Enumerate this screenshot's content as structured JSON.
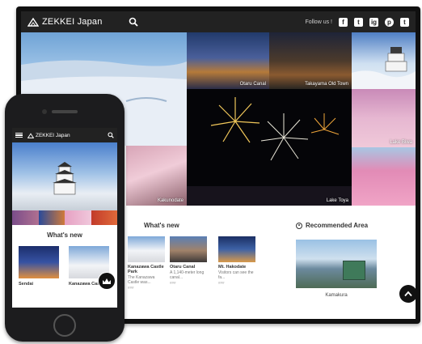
{
  "site": {
    "logo_text": "ZEKKEI Japan",
    "follow_label": "Follow us !",
    "social": [
      "f",
      "t",
      "ig",
      "p",
      "t"
    ]
  },
  "hero": {
    "tiles": [
      {
        "label": "Otaru Canal"
      },
      {
        "label": "Takayama Old Town"
      },
      {
        "label": "Lake Toya"
      },
      {
        "label": "Lake Biwa"
      },
      {
        "label": "Kakunodate"
      }
    ]
  },
  "whats_new": {
    "title": "What's new",
    "cards": [
      {
        "title": "Kanazawa Castle Park",
        "desc": "The Kanazawa Castle was...",
        "meta": "###"
      },
      {
        "title": "Otaru Canal",
        "desc": "A 1,140-meter long canal...",
        "meta": "###"
      },
      {
        "title": "Mt. Hakodate",
        "desc": "Visitors can see the fa...",
        "meta": "###"
      }
    ]
  },
  "recommended": {
    "title": "Recommended Area",
    "area": "Kamakura"
  },
  "phone": {
    "logo_text": "ZEKKEI Japan",
    "whats_new_title": "What's new",
    "cards": [
      {
        "label": "Sendai"
      },
      {
        "label": "Kanazawa Castle"
      }
    ]
  },
  "colors": {
    "header_bg": "#222222",
    "accent_dark": "#111111"
  }
}
